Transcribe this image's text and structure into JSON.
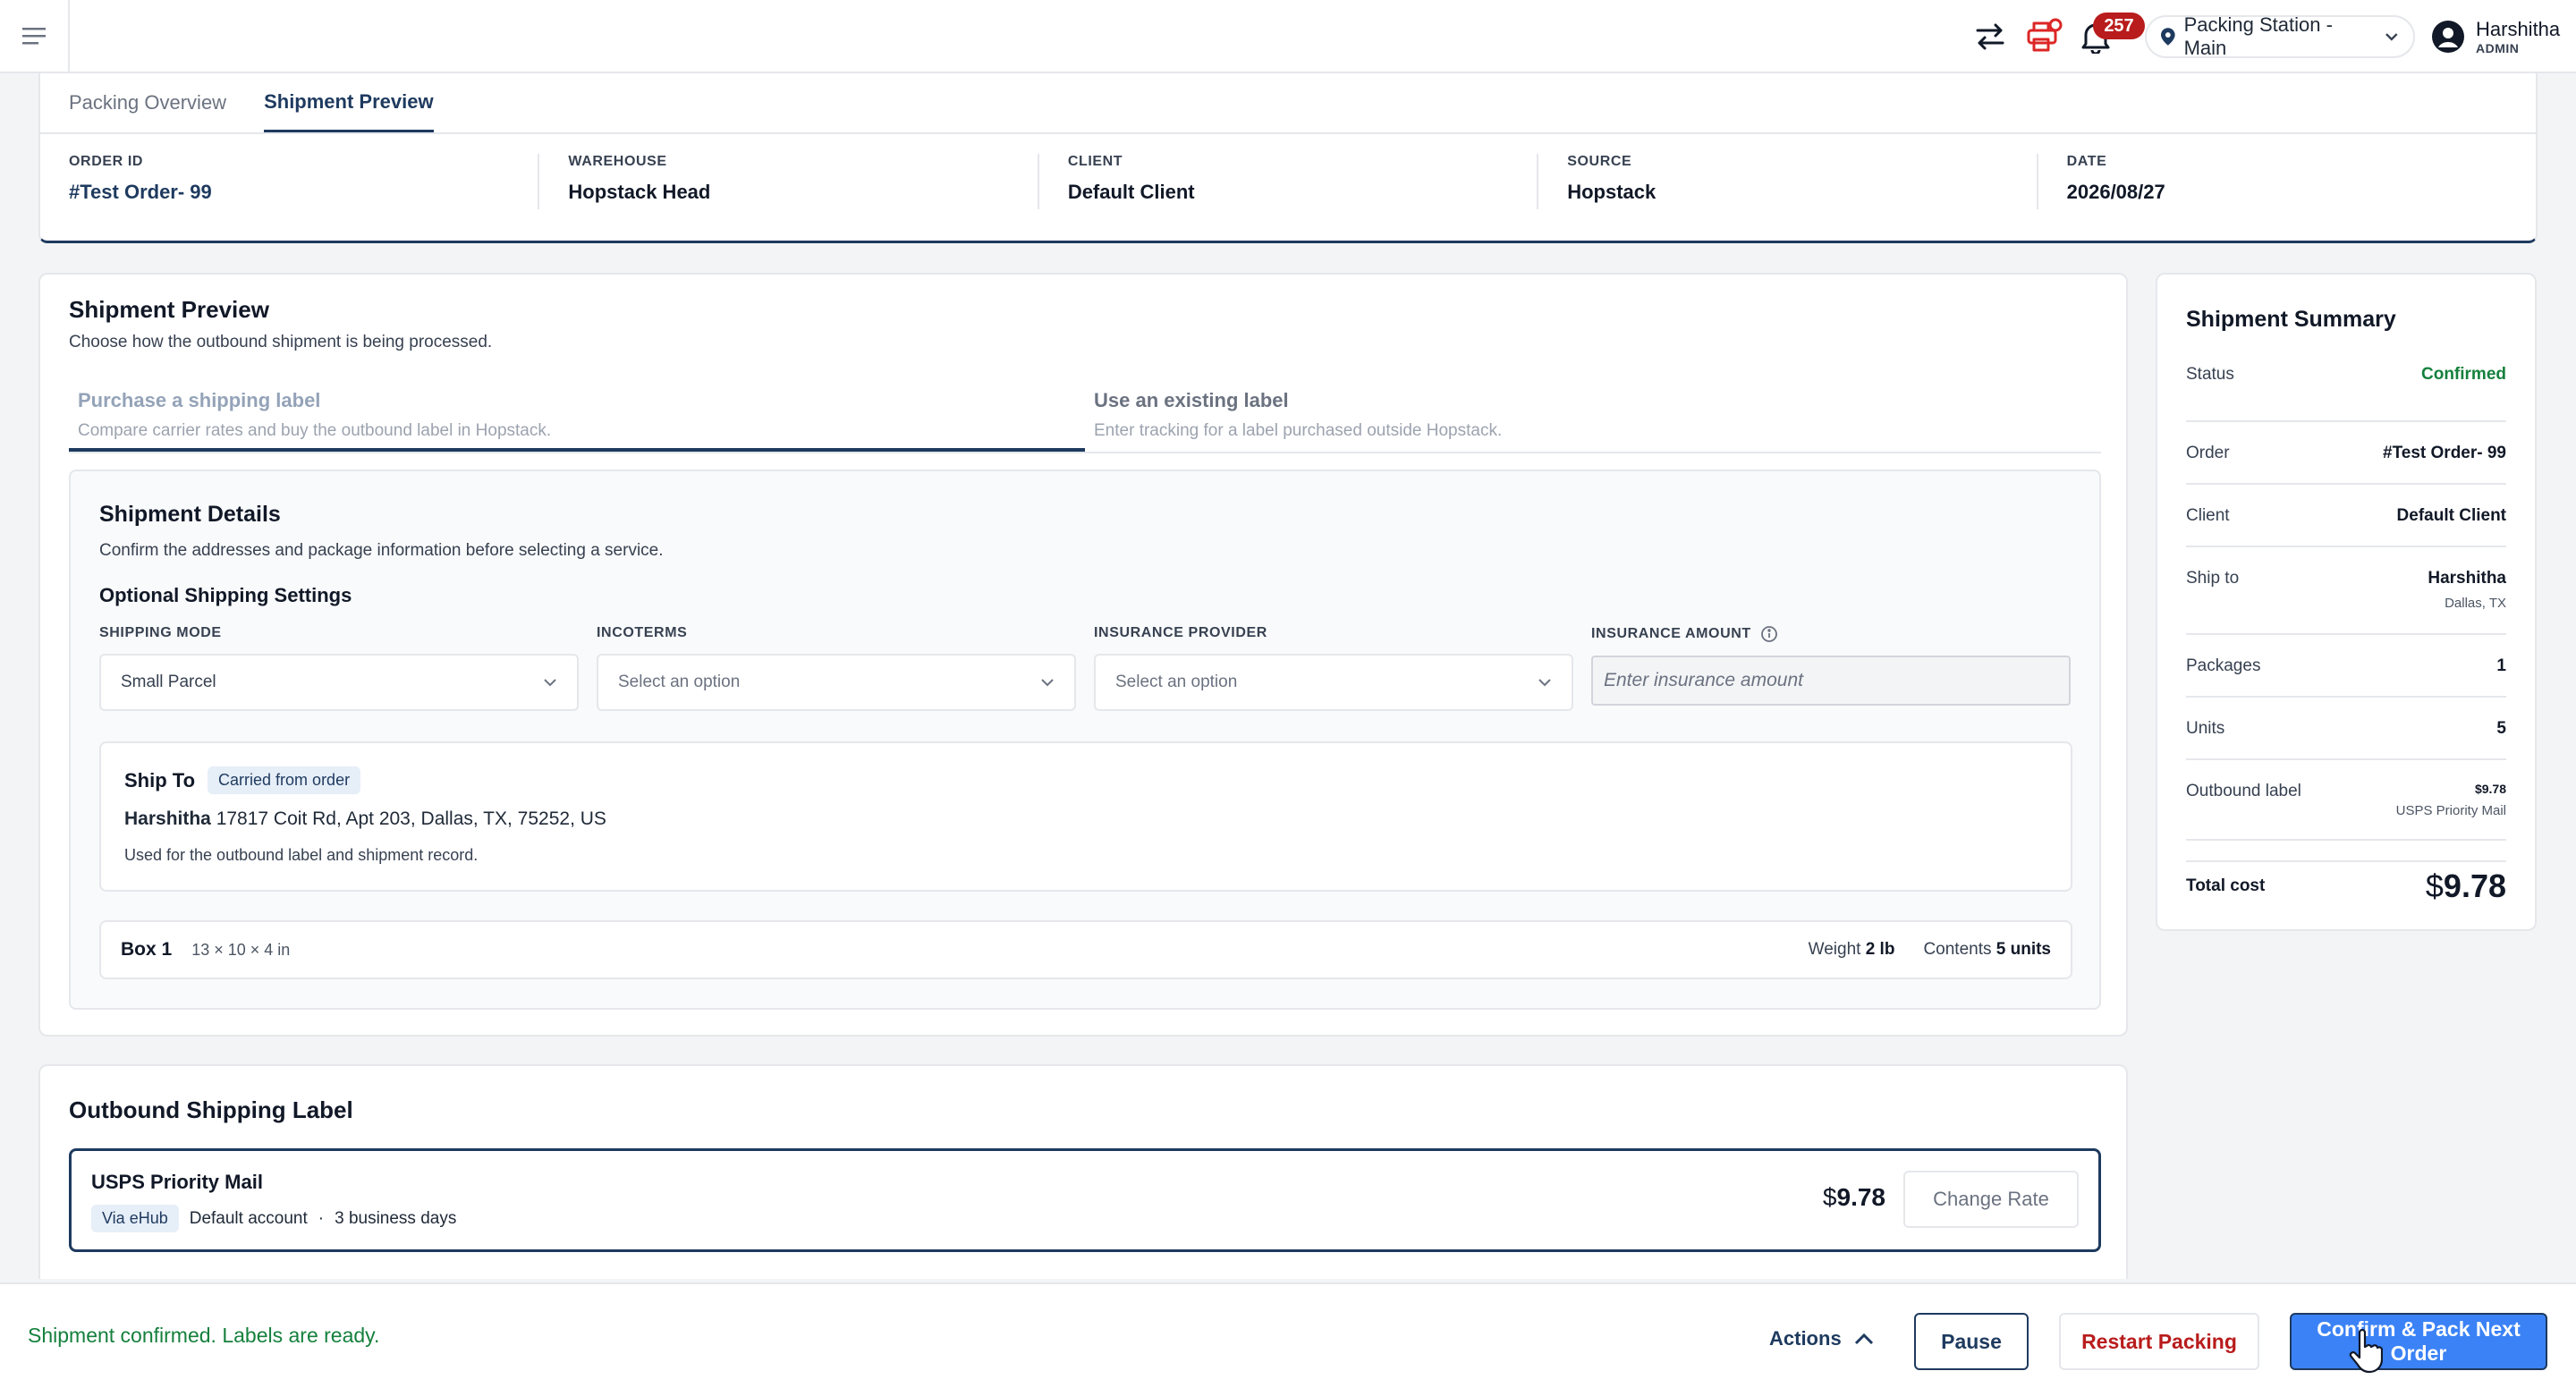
{
  "topbar": {
    "notification_count": "257",
    "station": "Packing Station - Main",
    "user_name": "Harshitha",
    "user_role": "ADMIN"
  },
  "tabs": [
    {
      "label": "Packing Overview",
      "active": false
    },
    {
      "label": "Shipment Preview",
      "active": true
    }
  ],
  "order_info": [
    {
      "label": "ORDER ID",
      "value": "#Test Order- 99"
    },
    {
      "label": "WAREHOUSE",
      "value": "Hopstack Head"
    },
    {
      "label": "CLIENT",
      "value": "Default Client"
    },
    {
      "label": "SOURCE",
      "value": "Hopstack"
    },
    {
      "label": "DATE",
      "value": "2026/08/27"
    }
  ],
  "preview": {
    "title": "Shipment Preview",
    "subtitle": "Choose how the outbound shipment is being processed.",
    "label_options": [
      {
        "title": "Purchase a shipping label",
        "desc": "Compare carrier rates and buy the outbound label in Hopstack.",
        "active": true
      },
      {
        "title": "Use an existing label",
        "desc": "Enter tracking for a label purchased outside Hopstack.",
        "active": false
      }
    ],
    "details": {
      "title": "Shipment Details",
      "subtitle": "Confirm the addresses and package information before selecting a service.",
      "optional_title": "Optional Shipping Settings",
      "fields": {
        "shipping_mode": {
          "label": "SHIPPING MODE",
          "value": "Small Parcel"
        },
        "incoterms": {
          "label": "INCOTERMS",
          "value": "Select an option"
        },
        "insurance_provider": {
          "label": "INSURANCE PROVIDER",
          "value": "Select an option"
        },
        "insurance_amount": {
          "label": "INSURANCE AMOUNT",
          "placeholder": "Enter insurance amount"
        }
      },
      "ship_to": {
        "title": "Ship To",
        "chip": "Carried from order",
        "name": "Harshitha",
        "address": "17817 Coit Rd, Apt 203, Dallas, TX, 75252, US",
        "note": "Used for the outbound label and shipment record."
      },
      "box": {
        "name": "Box 1",
        "dims": "13 × 10 × 4 in",
        "weight_label": "Weight",
        "weight": "2 lb",
        "contents_label": "Contents",
        "contents": "5 units"
      }
    }
  },
  "outbound": {
    "title": "Outbound Shipping Label",
    "carrier": "USPS Priority Mail",
    "via": "Via eHub",
    "account": "Default account",
    "separator": "·",
    "transit": "3 business days",
    "currency": "$",
    "price": "9.78",
    "change_rate": "Change Rate"
  },
  "summary": {
    "title": "Shipment Summary",
    "rows": {
      "status": {
        "label": "Status",
        "value": "Confirmed"
      },
      "order": {
        "label": "Order",
        "value": "#Test Order- 99"
      },
      "client": {
        "label": "Client",
        "value": "Default Client"
      },
      "ship_to": {
        "label": "Ship to",
        "value": "Harshitha",
        "sub": "Dallas, TX"
      },
      "packages": {
        "label": "Packages",
        "value": "1"
      },
      "units": {
        "label": "Units",
        "value": "5"
      },
      "outbound_label": {
        "label": "Outbound label",
        "value": "$9.78",
        "sub": "USPS Priority Mail"
      }
    },
    "total_label": "Total cost",
    "total_currency": "$",
    "total_value": "9.78"
  },
  "bottom": {
    "status": "Shipment confirmed. Labels are ready.",
    "actions": "Actions",
    "pause": "Pause",
    "restart": "Restart Packing",
    "confirm": "Confirm & Pack Next Order"
  },
  "colors": {
    "primary": "#1e3a5f",
    "success": "#15803d",
    "danger": "#b91c1c",
    "confirm_button": "#3b82f6"
  }
}
